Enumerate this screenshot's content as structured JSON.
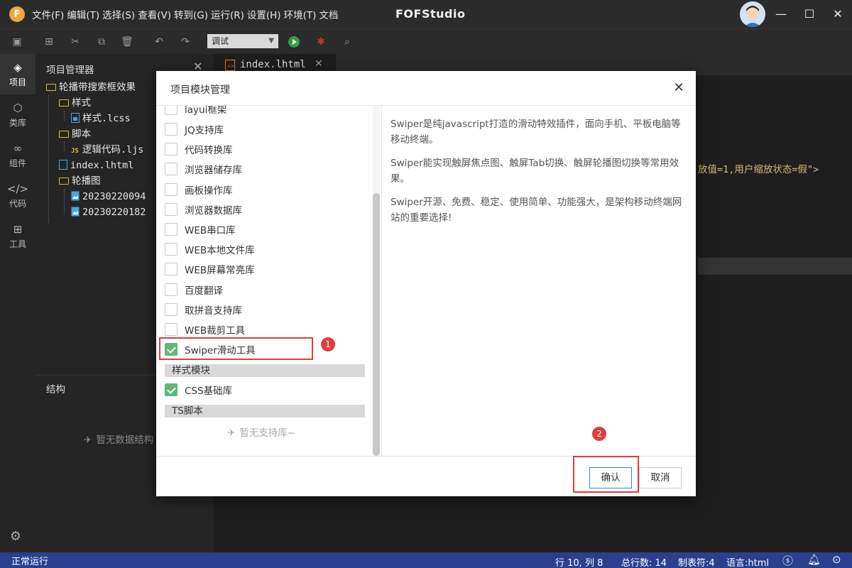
{
  "window": {
    "app_title": "FOFStudio",
    "menu": [
      "文件(F)",
      "编辑(T)",
      "选择(S)",
      "查看(V)",
      "转到(G)",
      "运行(R)",
      "设置(H)",
      "环境(T)",
      "文档"
    ]
  },
  "toolbar": {
    "mode_select_value": "调试"
  },
  "activitybar": {
    "items": [
      {
        "label": "项目",
        "icon": "layers-icon"
      },
      {
        "label": "类库",
        "icon": "cube-icon"
      },
      {
        "label": "组件",
        "icon": "link-icon"
      },
      {
        "label": "代码",
        "icon": "code-icon"
      },
      {
        "label": "工具",
        "icon": "grid-plus-icon"
      }
    ]
  },
  "project_panel": {
    "title": "项目管理器",
    "tree": [
      {
        "label": "轮播带搜索框效果",
        "type": "folder"
      },
      {
        "label": "样式",
        "type": "folder"
      },
      {
        "label": "样式.lcss",
        "type": "file"
      },
      {
        "label": "脚本",
        "type": "folder"
      },
      {
        "label": "逻辑代码.ljs",
        "type": "js"
      },
      {
        "label": "index.lhtml",
        "type": "html"
      },
      {
        "label": "轮播图",
        "type": "folder"
      },
      {
        "label": "20230220094",
        "type": "image"
      },
      {
        "label": "20230220182",
        "type": "image"
      }
    ],
    "structure_title": "结构",
    "structure_empty": "暂无数据结构"
  },
  "editor": {
    "tab_label": "index.lhtml",
    "code_fragment": "放值=1,用户缩放状态=假\">"
  },
  "modal": {
    "title": "项目模块管理",
    "libraries": [
      {
        "label": "layui框架",
        "checked": false
      },
      {
        "label": "JQ支持库",
        "checked": false
      },
      {
        "label": "代码转换库",
        "checked": false
      },
      {
        "label": "浏览器储存库",
        "checked": false
      },
      {
        "label": "画板操作库",
        "checked": false
      },
      {
        "label": "浏览器数据库",
        "checked": false
      },
      {
        "label": "WEB串口库",
        "checked": false
      },
      {
        "label": "WEB本地文件库",
        "checked": false
      },
      {
        "label": "WEB屏幕常亮库",
        "checked": false
      },
      {
        "label": "百度翻译",
        "checked": false
      },
      {
        "label": "取拼音支持库",
        "checked": false
      },
      {
        "label": "WEB裁剪工具",
        "checked": false
      },
      {
        "label": "Swiper滑动工具",
        "checked": true
      }
    ],
    "style_section": "样式模块",
    "style_libraries": [
      {
        "label": "CSS基础库",
        "checked": true
      }
    ],
    "ts_section": "TS脚本",
    "no_library": "暂无支持库~",
    "description": [
      "Swiper是纯javascript打造的滑动特效插件，面向手机、平板电脑等移动终端。",
      "Swiper能实现触屏焦点图、触屏Tab切换、触屏轮播图切换等常用效果。",
      "Swiper开源、免费、稳定、使用简单、功能强大，是架构移动终端网站的重要选择!"
    ],
    "confirm_label": "确认",
    "cancel_label": "取消",
    "annotation_1": "1",
    "annotation_2": "2"
  },
  "statusbar": {
    "state": "正常运行",
    "position": "行 10, 列 8",
    "total_lines": "总行数: 14",
    "tab_size": "制表符:4",
    "language": "语言:html"
  },
  "colors": {
    "accent_green": "#5fb878",
    "status_blue": "#2a3f8e",
    "annotation_red": "#e23c3c"
  }
}
